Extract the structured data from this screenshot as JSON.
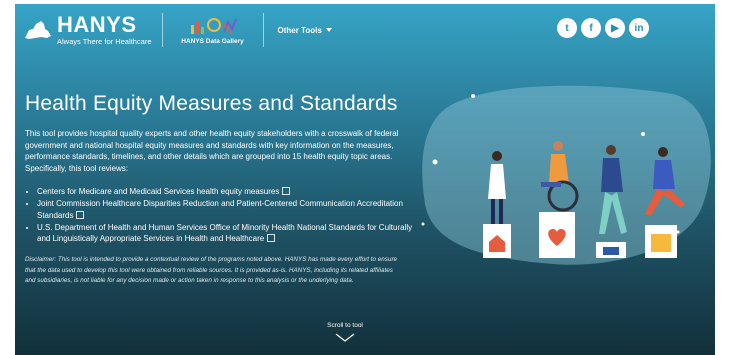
{
  "header": {
    "logo_name": "HANYS",
    "logo_tagline": "Always There for Healthcare",
    "gallery_label": "HANYS Data Gallery",
    "other_tools_label": "Other Tools",
    "social_icons": [
      "twitter-icon",
      "facebook-icon",
      "youtube-icon",
      "linkedin-icon"
    ],
    "social_glyphs": [
      "t",
      "f",
      "▶",
      "in"
    ]
  },
  "main": {
    "title": "Health Equity Measures and Standards",
    "intro": "This tool provides hospital quality experts and other health equity stakeholders with a crosswalk of federal government and national hospital equity measures and standards with key information on the measures, performance standards, timelines, and other details which are grouped into 15 health equity topic areas. Specifically, this tool reviews:",
    "bullets": [
      "Centers for Medicare and Medicaid Services health equity measures",
      "Joint Commission Healthcare Disparities Reduction and Patient-Centered Communication Accreditation Standards",
      "U.S. Department of Health and Human Services Office of Minority Health National Standards for Culturally and Linguistically Appropriate Services in Health and Healthcare"
    ],
    "disclaimer": "Disclaimer: This tool is intended to provide a contextual review of the programs noted above. HANYS has made every effort to ensure that the data used to develop this tool were obtained from reliable sources. It is provided as-is. HANYS, including its related affiliates and subsidiaries, is not liable for any decision made or action taken in response to this analysis or the underlying data.",
    "scroll_label": "Scroll to tool"
  },
  "colors": {
    "gradient_top": "#36a4c6",
    "gradient_bottom": "#12303b",
    "blob": "#8ec8da"
  }
}
